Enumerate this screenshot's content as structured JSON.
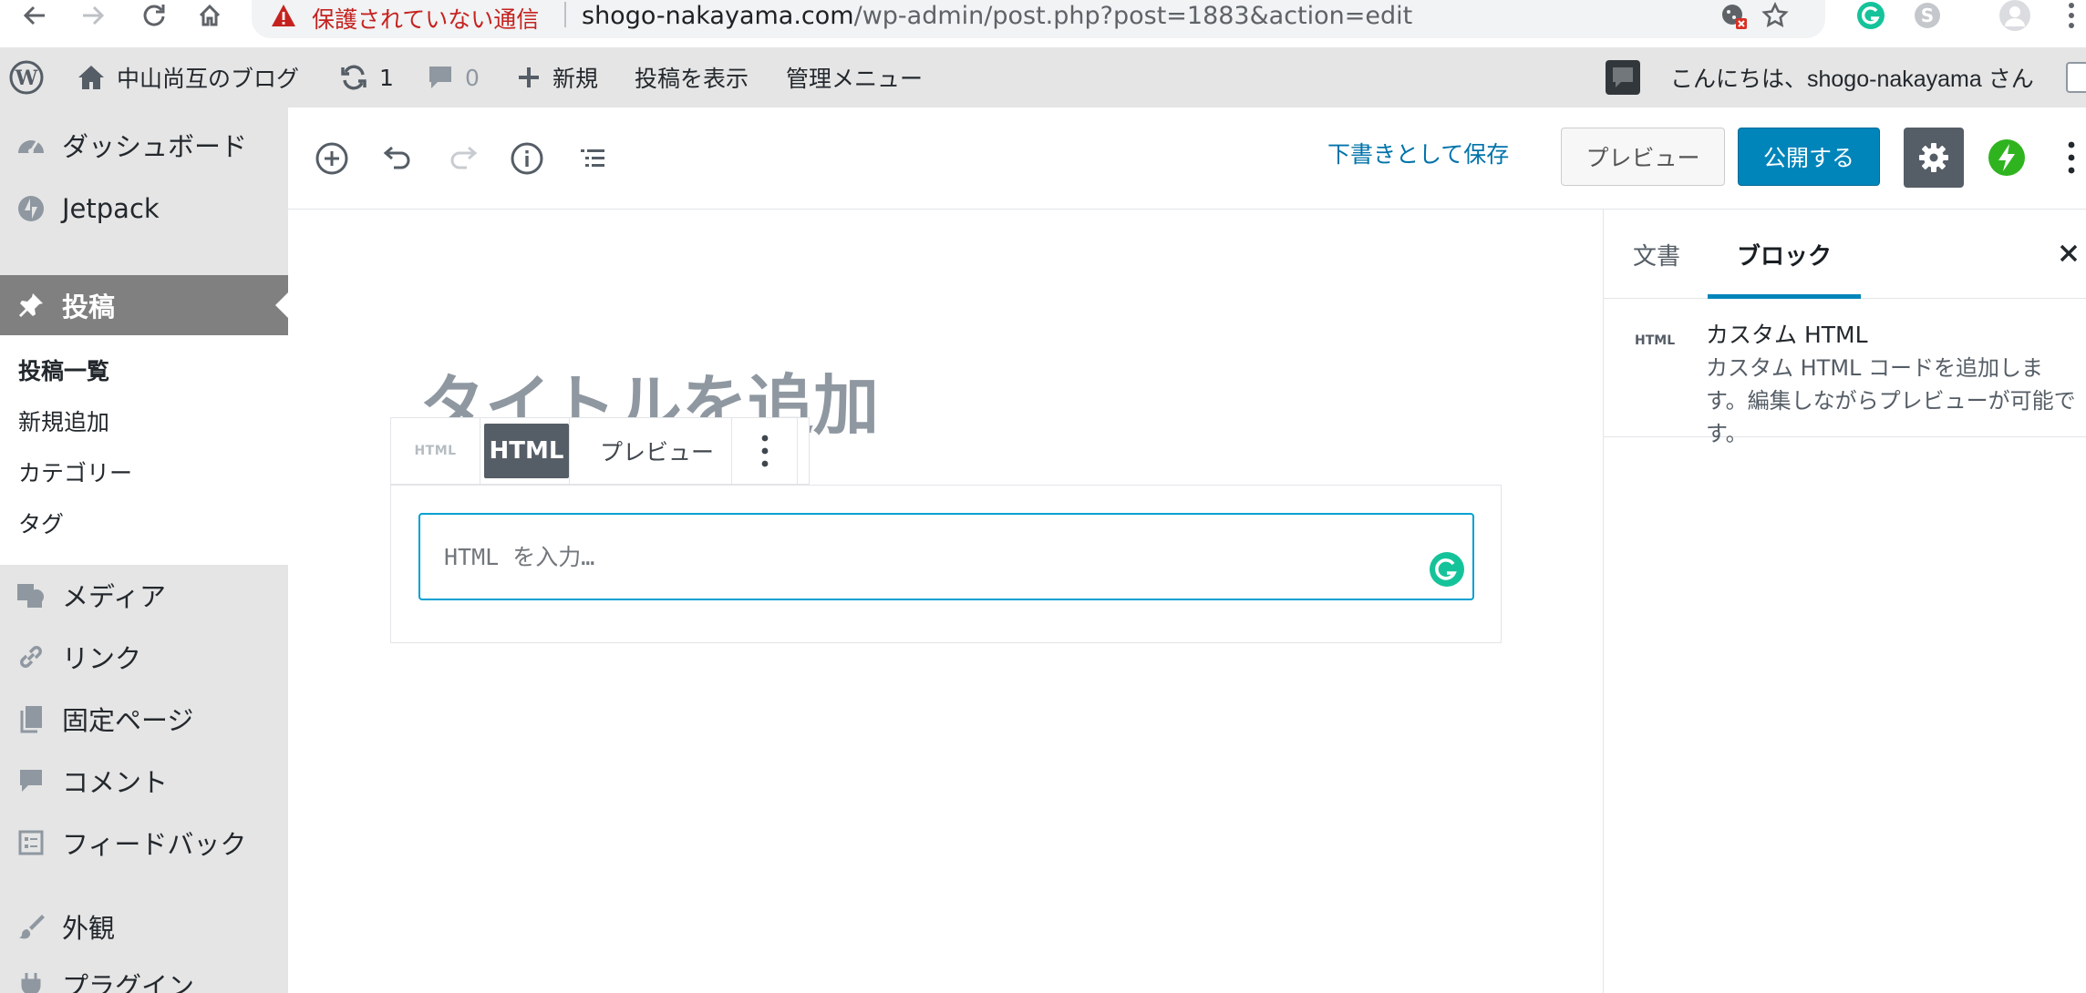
{
  "browser": {
    "security_label": "保護されていない通信",
    "url_host": "shogo-nakayama.com",
    "url_path": "/wp-admin/post.php?post=1883&action=edit"
  },
  "admin_bar": {
    "site_name": "中山尚互のブログ",
    "updates_count": "1",
    "comments_count": "0",
    "new_label": "新規",
    "view_post_label": "投稿を表示",
    "admin_menu_label": "管理メニュー",
    "greeting": "こんにちは、shogo-nakayama さん"
  },
  "menu": {
    "dashboard": "ダッシュボード",
    "jetpack": "Jetpack",
    "posts": "投稿",
    "posts_sub": [
      "投稿一覧",
      "新規追加",
      "カテゴリー",
      "タグ"
    ],
    "media": "メディア",
    "links": "リンク",
    "pages": "固定ページ",
    "comments": "コメント",
    "feedback": "フィードバック",
    "appearance": "外観",
    "plugins": "プラグイン"
  },
  "editor": {
    "save_draft": "下書きとして保存",
    "preview": "プレビュー",
    "publish": "公開する",
    "title_placeholder": "タイトルを追加"
  },
  "block": {
    "type_icon_label": "HTML",
    "html_tab": "HTML",
    "preview_tab": "プレビュー",
    "input_placeholder": "HTML を入力…"
  },
  "sidebar": {
    "tab_document": "文書",
    "tab_block": "ブロック",
    "block_icon_label": "HTML",
    "block_title": "カスタム HTML",
    "block_description": "カスタム HTML コードを追加します。編集しながらプレビューが可能です。"
  },
  "colors": {
    "accent": "#0085ba",
    "link": "#0073aa",
    "warning": "#c5221f",
    "jetpack": "#2fb41f",
    "grammarly": "#15c39a"
  }
}
